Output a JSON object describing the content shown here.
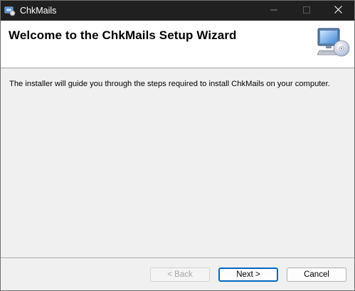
{
  "window": {
    "title": "ChkMails",
    "controls": {
      "minimize_icon": "minimize-icon",
      "maximize_icon": "maximize-icon",
      "close_icon": "close-icon"
    }
  },
  "header": {
    "title": "Welcome to the ChkMails Setup Wizard",
    "graphic_icon": "computer-cd-icon"
  },
  "body": {
    "text": "The installer will guide you through the steps required to install ChkMails on your computer."
  },
  "buttons": {
    "back": {
      "label": "< Back",
      "enabled": false
    },
    "next": {
      "label": "Next >",
      "enabled": true
    },
    "cancel": {
      "label": "Cancel",
      "enabled": true
    }
  },
  "colors": {
    "titlebar": "#202020",
    "dialog_bg": "#f0f0f0",
    "header_bg": "#ffffff",
    "accent": "#0067c0"
  }
}
